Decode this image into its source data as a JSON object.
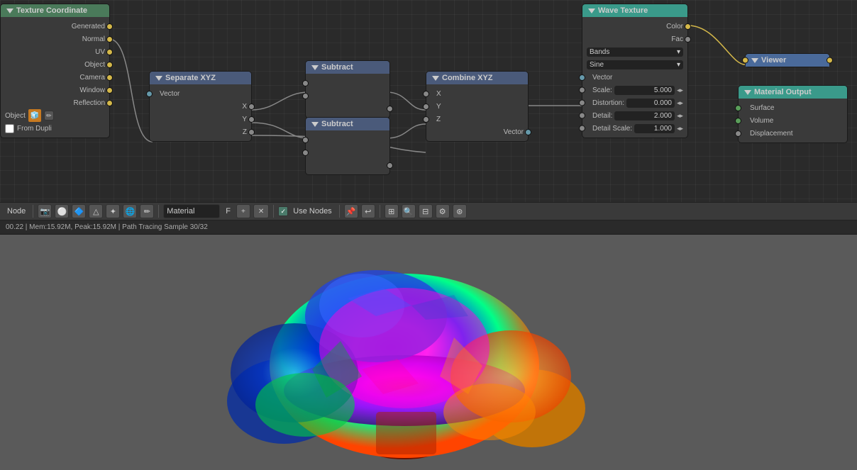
{
  "nodes": {
    "texcoord": {
      "title": "Texture Coordinate",
      "outputs": [
        "Generated",
        "Normal",
        "UV",
        "Object",
        "Camera",
        "Window",
        "Reflection"
      ],
      "extras": [
        "Object",
        "From Dupli"
      ]
    },
    "sep_xyz": {
      "title": "Separate XYZ",
      "input": "Vector",
      "outputs": [
        "X",
        "Y",
        "Z"
      ]
    },
    "sub1": {
      "title": "Subtract"
    },
    "sub2": {
      "title": "Subtract"
    },
    "comb_xyz": {
      "title": "Combine XYZ",
      "input": "Vector",
      "outputs": [
        "X",
        "Y",
        "Z"
      ]
    },
    "wave": {
      "title": "Wave Texture",
      "outputs": [
        "Color",
        "Fac"
      ],
      "dropdowns": [
        "Bands",
        "Sine"
      ],
      "inputs": [
        {
          "label": "Vector",
          "type": "socket"
        },
        {
          "label": "Scale:",
          "value": "5.000"
        },
        {
          "label": "Distortion:",
          "value": "0.000"
        },
        {
          "label": "Detail:",
          "value": "2.000"
        },
        {
          "label": "Detail Scale:",
          "value": "1.000"
        }
      ]
    },
    "viewer": {
      "title": "Viewer"
    },
    "mat_output": {
      "title": "Material Output",
      "inputs": [
        "Surface",
        "Volume",
        "Displacement"
      ]
    }
  },
  "toolbar": {
    "mode_label": "Node",
    "material_label": "Material",
    "use_nodes_label": "Use Nodes",
    "f_label": "F",
    "plus_label": "+",
    "x_label": "✕"
  },
  "statusbar": {
    "text": "00.22 | Mem:15.92M, Peak:15.92M | Path Tracing Sample 30/32"
  },
  "viewport": {
    "description": "3D viewport with colorful mushroom"
  }
}
